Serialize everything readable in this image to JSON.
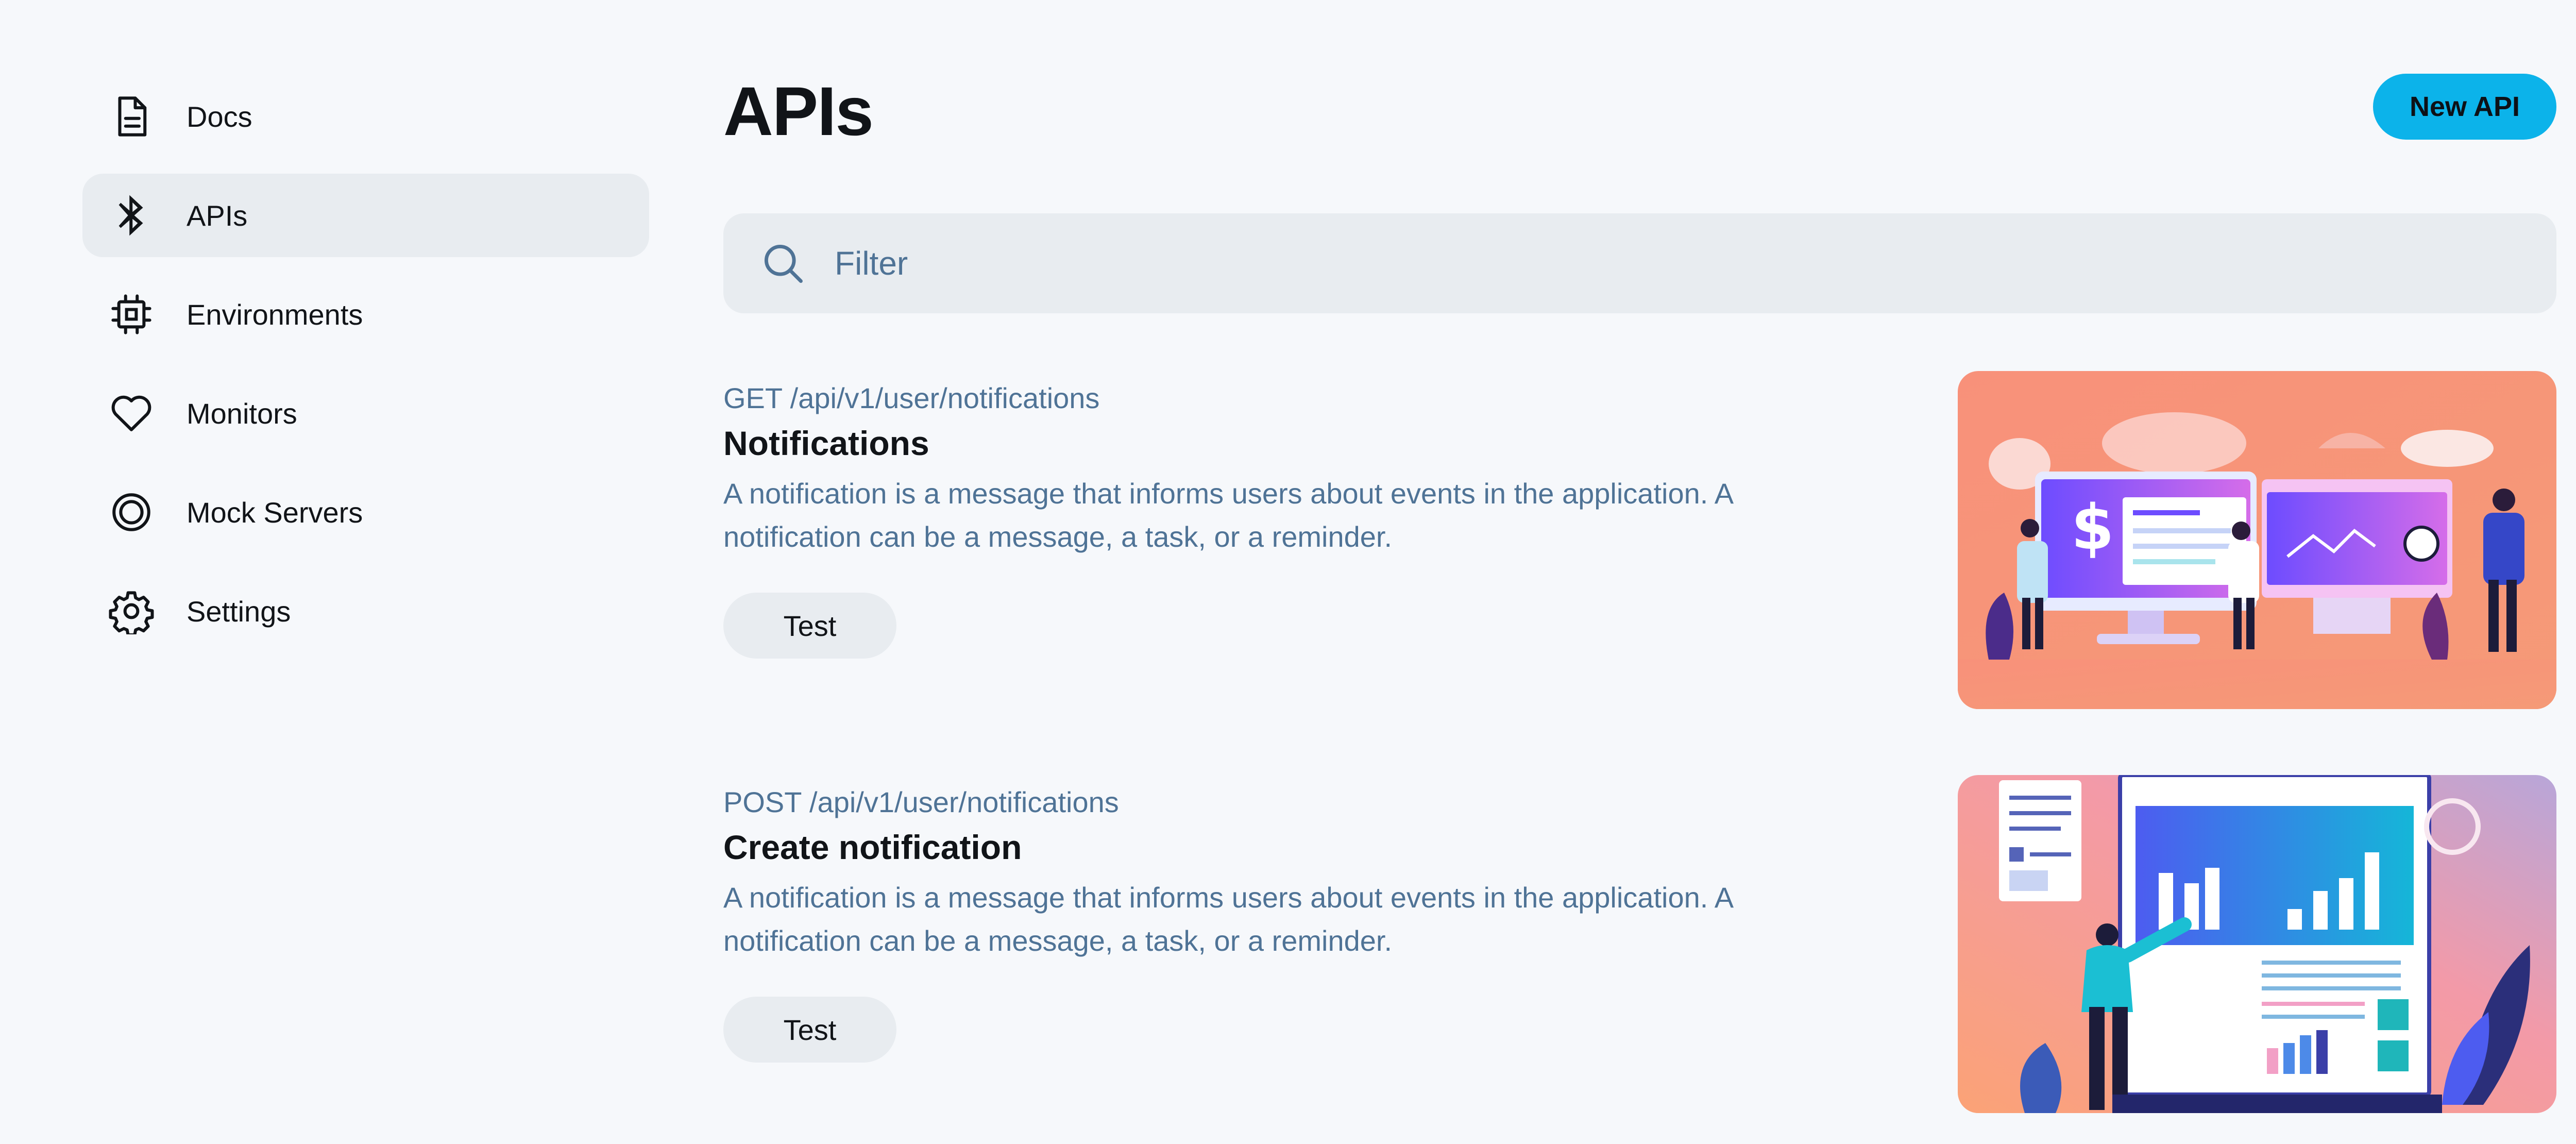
{
  "sidebar": {
    "items": [
      {
        "label": "Docs",
        "icon": "document-icon",
        "active": false
      },
      {
        "label": "APIs",
        "icon": "bluetooth-icon",
        "active": true
      },
      {
        "label": "Environments",
        "icon": "cpu-icon",
        "active": false
      },
      {
        "label": "Monitors",
        "icon": "heart-icon",
        "active": false
      },
      {
        "label": "Mock Servers",
        "icon": "record-icon",
        "active": false
      },
      {
        "label": "Settings",
        "icon": "gear-icon",
        "active": false
      }
    ]
  },
  "header": {
    "title": "APIs",
    "new_button_label": "New API"
  },
  "search": {
    "placeholder": "Filter",
    "value": ""
  },
  "apis": [
    {
      "endpoint": "GET /api/v1/user/notifications",
      "name": "Notifications",
      "description": "A notification is a message that informs users about events in the application. A notification can be a message, a task, or a reminder.",
      "button_label": "Test",
      "image": "notifications-illustration"
    },
    {
      "endpoint": "POST /api/v1/user/notifications",
      "name": "Create notification",
      "description": "A notification is a message that informs users about events in the application. A notification can be a message, a task, or a reminder.",
      "button_label": "Test",
      "image": "create-notification-illustration"
    }
  ],
  "colors": {
    "background": "#f6f8fb",
    "accent": "#0cb3ea",
    "muted_text": "#4f7396",
    "surface": "#e8ecf0"
  }
}
